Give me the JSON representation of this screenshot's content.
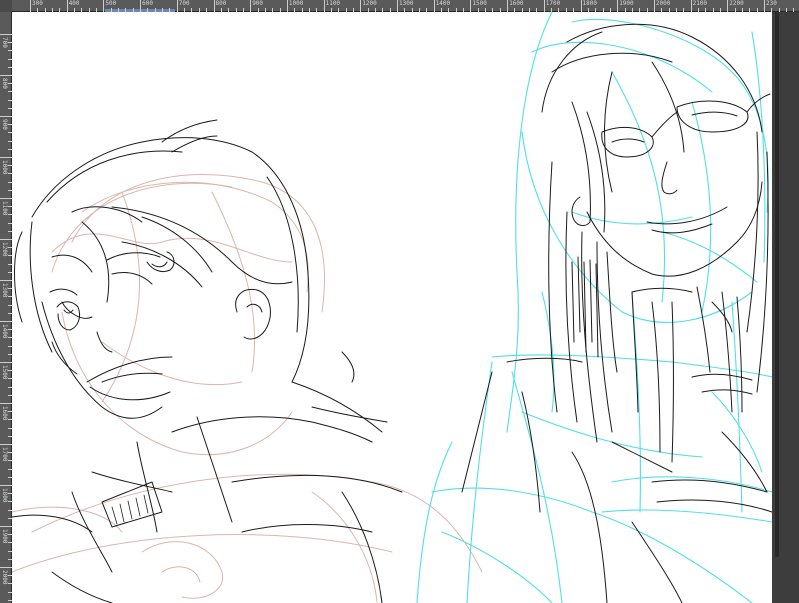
{
  "ruler": {
    "top_labels": [
      "300",
      "400",
      "500",
      "600",
      "700",
      "800",
      "900",
      "1000",
      "1100",
      "1200",
      "1300",
      "1400",
      "1500",
      "1600",
      "1700",
      "1800",
      "1900",
      "2000",
      "2100",
      "2200",
      "230"
    ],
    "left_labels": [
      "700",
      "800",
      "900",
      "1000",
      "1100",
      "1200",
      "1300",
      "1400",
      "1500",
      "1600",
      "1700",
      "1800",
      "1900",
      "2000"
    ]
  },
  "canvas": {
    "background": "#ffffff",
    "layers": [
      "ink-lines",
      "pink-rough-sketch",
      "cyan-rough-sketch"
    ],
    "colors": {
      "ink": "#1a1a1a",
      "pink": "#d8b6b0",
      "cyan": "#4fe0e6"
    }
  }
}
